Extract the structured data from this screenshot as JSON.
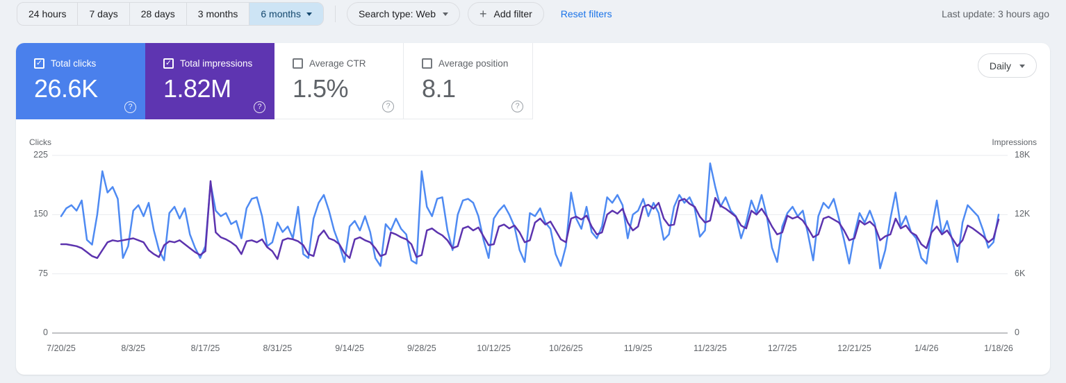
{
  "topbar": {
    "ranges": [
      {
        "label": "24 hours",
        "selected": false
      },
      {
        "label": "7 days",
        "selected": false
      },
      {
        "label": "28 days",
        "selected": false
      },
      {
        "label": "3 months",
        "selected": false
      },
      {
        "label": "6 months",
        "selected": true
      }
    ],
    "search_type_label": "Search type: Web",
    "add_filter_label": "Add filter",
    "reset_filters_label": "Reset filters",
    "last_update": "Last update: 3 hours ago"
  },
  "metrics": [
    {
      "label": "Total clicks",
      "value": "26.6K",
      "checked": true,
      "color": "#4a80ec"
    },
    {
      "label": "Total impressions",
      "value": "1.82M",
      "checked": true,
      "color": "#5e35b1"
    },
    {
      "label": "Average CTR",
      "value": "1.5%",
      "checked": false
    },
    {
      "label": "Average position",
      "value": "8.1",
      "checked": false
    }
  ],
  "granularity": {
    "label": "Daily"
  },
  "colors": {
    "accent_link": "#1a73e8",
    "clicks_blue": "#4a80ec",
    "impressions_purple": "#5e35b1",
    "selected_range_bg": "#cde4f5"
  },
  "chart_data": {
    "type": "line",
    "title": "Search performance over time",
    "grid": true,
    "legend_position": "none",
    "left_axis": {
      "label": "Clicks",
      "ticks": [
        "225",
        "150",
        "75",
        "0"
      ],
      "tick_values": [
        225,
        150,
        75,
        0
      ],
      "max": 225
    },
    "right_axis": {
      "label": "Impressions",
      "ticks": [
        "18K",
        "12K",
        "6K",
        "0"
      ],
      "tick_values": [
        18000,
        12000,
        6000,
        0
      ],
      "max": 18000
    },
    "x_tick_labels": [
      "7/20/25",
      "8/3/25",
      "8/17/25",
      "8/31/25",
      "9/14/25",
      "9/28/25",
      "10/12/25",
      "10/26/25",
      "11/9/25",
      "11/23/25",
      "12/7/25",
      "12/21/25",
      "1/4/26",
      "1/18/26"
    ],
    "x_tick_day_indices": [
      0,
      14,
      28,
      42,
      56,
      70,
      84,
      98,
      112,
      126,
      140,
      154,
      168,
      182
    ],
    "series": [
      {
        "name": "Total clicks",
        "axis": "left",
        "color": "#4e8af2",
        "values": [
          148,
          158,
          162,
          155,
          168,
          118,
          112,
          150,
          205,
          178,
          185,
          170,
          95,
          110,
          155,
          162,
          148,
          165,
          130,
          105,
          92,
          152,
          160,
          145,
          158,
          125,
          108,
          95,
          110,
          190,
          155,
          148,
          152,
          138,
          142,
          120,
          158,
          170,
          172,
          148,
          110,
          115,
          140,
          128,
          135,
          120,
          160,
          100,
          95,
          145,
          165,
          175,
          155,
          130,
          112,
          90,
          135,
          142,
          130,
          148,
          128,
          95,
          85,
          138,
          130,
          145,
          132,
          125,
          92,
          88,
          205,
          160,
          148,
          170,
          172,
          130,
          105,
          150,
          168,
          170,
          165,
          148,
          118,
          95,
          145,
          155,
          162,
          150,
          135,
          105,
          90,
          152,
          148,
          158,
          140,
          132,
          100,
          85,
          110,
          178,
          145,
          132,
          160,
          128,
          120,
          135,
          172,
          165,
          175,
          162,
          120,
          150,
          155,
          170,
          148,
          165,
          152,
          118,
          125,
          160,
          175,
          165,
          172,
          158,
          122,
          130,
          215,
          185,
          160,
          172,
          155,
          148,
          120,
          140,
          168,
          152,
          175,
          148,
          108,
          90,
          135,
          152,
          160,
          148,
          155,
          125,
          92,
          148,
          165,
          158,
          170,
          145,
          118,
          88,
          125,
          152,
          140,
          155,
          138,
          82,
          105,
          145,
          178,
          135,
          148,
          128,
          120,
          95,
          88,
          132,
          168,
          125,
          142,
          118,
          90,
          140,
          162,
          155,
          148,
          130,
          108,
          115,
          150
        ]
      },
      {
        "name": "Total impressions",
        "axis": "right",
        "color": "#5c33ae",
        "values": [
          9000,
          9000,
          8900,
          8800,
          8600,
          8200,
          7800,
          7600,
          8400,
          9200,
          9400,
          9300,
          9400,
          9500,
          9600,
          9400,
          9200,
          8400,
          8000,
          7700,
          8900,
          9300,
          9200,
          9400,
          9000,
          8600,
          8200,
          7900,
          8300,
          15400,
          10200,
          9700,
          9500,
          9200,
          8800,
          8000,
          9300,
          9400,
          9200,
          9500,
          8700,
          8300,
          7500,
          9400,
          9600,
          9500,
          9300,
          8900,
          8000,
          7800,
          9800,
          10400,
          9600,
          9400,
          9000,
          8100,
          7600,
          9500,
          9700,
          9400,
          9200,
          8600,
          7800,
          8000,
          10200,
          10000,
          9700,
          9500,
          9000,
          7700,
          7900,
          10400,
          10600,
          10200,
          9900,
          9400,
          8600,
          8800,
          10600,
          10800,
          10400,
          10700,
          9800,
          8900,
          9000,
          10800,
          11000,
          10600,
          10900,
          10200,
          9200,
          9400,
          11200,
          11600,
          11000,
          11300,
          10400,
          9500,
          9200,
          11600,
          11800,
          11500,
          11900,
          10800,
          10000,
          10200,
          12000,
          12400,
          12100,
          12600,
          11200,
          10400,
          10800,
          12800,
          13000,
          12600,
          13200,
          11600,
          10900,
          11000,
          13400,
          13600,
          13100,
          12800,
          11800,
          11200,
          11400,
          13700,
          12900,
          12600,
          12200,
          11800,
          10900,
          10600,
          12400,
          12000,
          12600,
          11800,
          10800,
          10000,
          10200,
          11900,
          11600,
          11800,
          11400,
          10600,
          9700,
          10000,
          11600,
          11800,
          11500,
          11200,
          10400,
          9400,
          9600,
          11400,
          11000,
          11300,
          10800,
          9400,
          9800,
          10000,
          11600,
          10600,
          10900,
          10200,
          9900,
          9000,
          8600,
          10200,
          10800,
          10000,
          10400,
          9600,
          8800,
          9400,
          10900,
          10600,
          10200,
          9800,
          9200,
          9600,
          11500
        ]
      }
    ]
  }
}
